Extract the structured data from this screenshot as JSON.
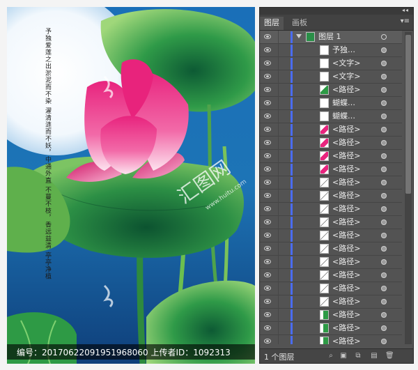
{
  "artwork": {
    "poem_columns": [
      "予独爱莲之出淤泥而不染",
      "濯清涟而不妖，中通外直",
      "不蔓不枝，香远益清",
      "亭亭净植"
    ]
  },
  "layers_panel": {
    "collapse_glyph": "◂◂",
    "close_glyph": "×",
    "tabs": [
      {
        "label": "图层"
      },
      {
        "label": "画板"
      }
    ],
    "menu_glyph": "▾≡",
    "parent_layer": {
      "name": "图层 1"
    },
    "rows": [
      {
        "name": "予独…",
        "thumb": "text"
      },
      {
        "name": "<文字>",
        "thumb": "text"
      },
      {
        "name": "<文字>",
        "thumb": "blank"
      },
      {
        "name": "<路径>",
        "thumb": "leaf"
      },
      {
        "name": "蝴蝶…",
        "thumb": "blank"
      },
      {
        "name": "蝴蝶…",
        "thumb": "blank"
      },
      {
        "name": "<路径>",
        "thumb": "pink"
      },
      {
        "name": "<路径>",
        "thumb": "pink"
      },
      {
        "name": "<路径>",
        "thumb": "pink"
      },
      {
        "name": "<路径>",
        "thumb": "pink"
      },
      {
        "name": "<路径>",
        "thumb": "line"
      },
      {
        "name": "<路径>",
        "thumb": "line"
      },
      {
        "name": "<路径>",
        "thumb": "line"
      },
      {
        "name": "<路径>",
        "thumb": "line"
      },
      {
        "name": "<路径>",
        "thumb": "line"
      },
      {
        "name": "<路径>",
        "thumb": "line"
      },
      {
        "name": "<路径>",
        "thumb": "line"
      },
      {
        "name": "<路径>",
        "thumb": "line"
      },
      {
        "name": "<路径>",
        "thumb": "line"
      },
      {
        "name": "<路径>",
        "thumb": "line"
      },
      {
        "name": "<路径>",
        "thumb": "green"
      },
      {
        "name": "<路径>",
        "thumb": "green"
      },
      {
        "name": "<路径>",
        "thumb": "green"
      },
      {
        "name": "<路径>",
        "thumb": "line"
      }
    ],
    "footer": {
      "layer_count": "1 个图层",
      "buttons": [
        "search-icon",
        "make-clipping-mask-icon",
        "new-sublayer-icon",
        "new-layer-icon",
        "trash-icon"
      ]
    },
    "selection_color": "#4a6cf0"
  },
  "caption": {
    "text": "编号：20170622091951968060 上传者ID：1092313"
  },
  "watermark": {
    "brand": "汇图网",
    "url": "www.huitu.com"
  }
}
